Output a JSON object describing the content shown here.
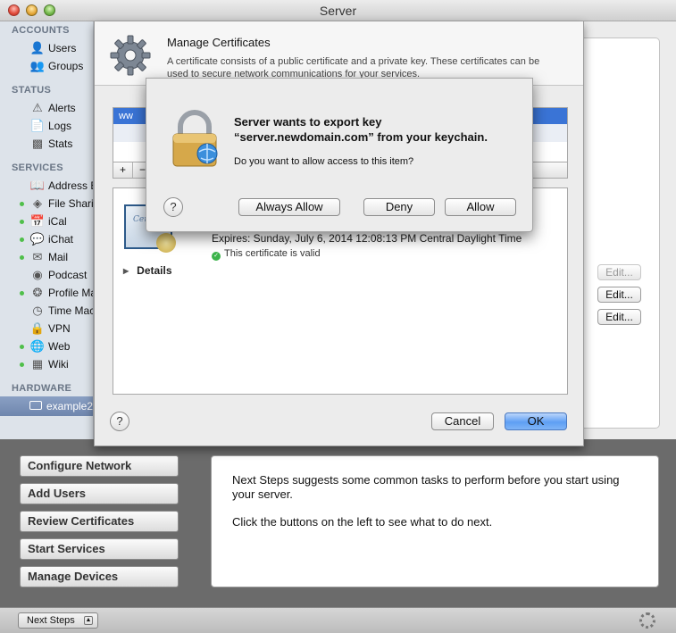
{
  "window": {
    "title": "Server"
  },
  "sidebar": {
    "sections": [
      {
        "header": "ACCOUNTS",
        "items": [
          {
            "label": "Users",
            "icon": "user-icon",
            "running": false
          },
          {
            "label": "Groups",
            "icon": "group-icon",
            "running": false
          }
        ]
      },
      {
        "header": "STATUS",
        "items": [
          {
            "label": "Alerts",
            "icon": "alert-icon",
            "running": false
          },
          {
            "label": "Logs",
            "icon": "logs-icon",
            "running": false
          },
          {
            "label": "Stats",
            "icon": "stats-icon",
            "running": false
          }
        ]
      },
      {
        "header": "SERVICES",
        "items": [
          {
            "label": "Address B",
            "icon": "address-book-icon",
            "running": false
          },
          {
            "label": "File Sharin",
            "icon": "file-sharing-icon",
            "running": true
          },
          {
            "label": "iCal",
            "icon": "calendar-icon",
            "running": true
          },
          {
            "label": "iChat",
            "icon": "chat-icon",
            "running": true
          },
          {
            "label": "Mail",
            "icon": "mail-icon",
            "running": true
          },
          {
            "label": "Podcast",
            "icon": "podcast-icon",
            "running": false
          },
          {
            "label": "Profile Ma",
            "icon": "profile-manager-icon",
            "running": true
          },
          {
            "label": "Time Mac",
            "icon": "time-machine-icon",
            "running": false
          },
          {
            "label": "VPN",
            "icon": "vpn-icon",
            "running": false
          },
          {
            "label": "Web",
            "icon": "web-globe-icon",
            "running": true
          },
          {
            "label": "Wiki",
            "icon": "wiki-icon",
            "running": true
          }
        ]
      },
      {
        "header": "HARDWARE",
        "items": []
      }
    ],
    "selected_hardware": "example2"
  },
  "edit_buttons": [
    {
      "label": "Edit...",
      "enabled": false
    },
    {
      "label": "Edit...",
      "enabled": true
    },
    {
      "label": "Edit...",
      "enabled": true
    }
  ],
  "sheet": {
    "title": "Manage Certificates",
    "description": "A certificate consists of a public certificate and a private key. These certificates can be used to secure network communications for your services.",
    "selected_cert": "ww",
    "list_tools": {
      "add": "+",
      "remove": "−"
    },
    "cert_icon_text": "Cer Stu",
    "expires": "Expires: Sunday, July 6, 2014 12:08:13 PM Central Daylight Time",
    "valid_text": "This certificate is valid",
    "details_label": "Details",
    "help": "?",
    "cancel_label": "Cancel",
    "ok_label": "OK"
  },
  "alert": {
    "title": "Server wants to export key “server.newdomain.com” from your keychain.",
    "message": "Do you want to allow access to this item?",
    "help": "?",
    "always_allow_label": "Always Allow",
    "deny_label": "Deny",
    "allow_label": "Allow"
  },
  "next_steps": {
    "buttons": [
      "Configure Network",
      "Add Users",
      "Review Certificates",
      "Start Services",
      "Manage Devices"
    ],
    "panel_p1": "Next Steps suggests some common tasks to perform before you start using your server.",
    "panel_p2": "Click the buttons on the left to see what to do next.",
    "toggle_label": "Next Steps"
  }
}
